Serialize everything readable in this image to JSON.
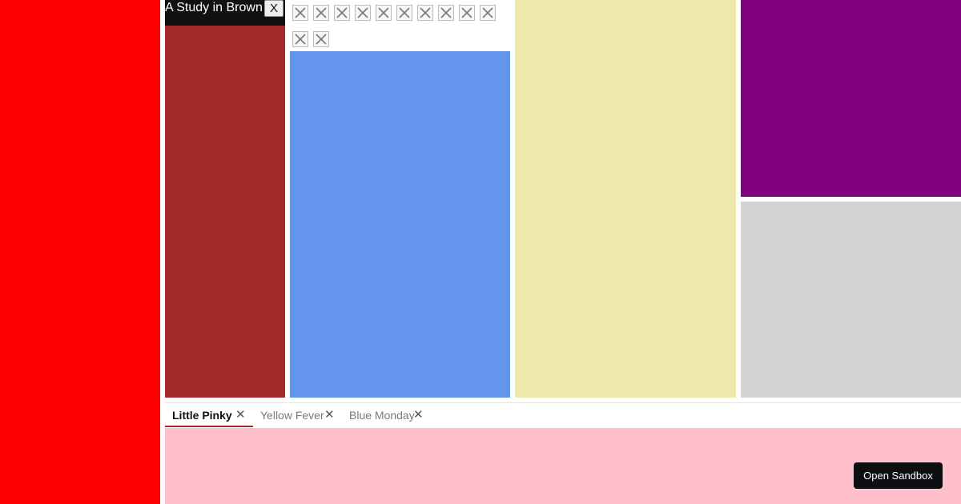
{
  "colors": {
    "red": "#ff0000",
    "brown": "#a52a2a",
    "blue": "#6495ed",
    "yellow": "#eee8aa",
    "purple": "#800080",
    "grey": "#d3d3d3",
    "pink": "#ffc0cb"
  },
  "brown_panel": {
    "title": "A Study in Brown",
    "close_label": "X"
  },
  "icon_strip": {
    "icons": [
      "close-icon",
      "close-icon",
      "close-icon",
      "close-icon",
      "close-icon",
      "close-icon",
      "close-icon",
      "close-icon",
      "close-icon",
      "close-icon",
      "close-icon",
      "close-icon"
    ]
  },
  "tabs": [
    {
      "label": "Little Pinky",
      "close": "✕",
      "active": true
    },
    {
      "label": "Yellow Fever",
      "close": "✕",
      "active": false
    },
    {
      "label": "Blue Monday",
      "close": "✕",
      "active": false
    }
  ],
  "sandbox": {
    "label": "Open Sandbox"
  }
}
